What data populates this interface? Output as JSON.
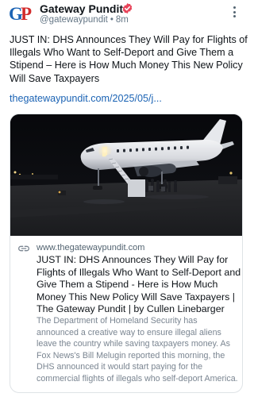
{
  "author": {
    "name": "Gateway Pundit",
    "handle": "@gatewaypundit",
    "separator": "•",
    "time": "8m",
    "avatar_letters": "GP",
    "verified": true
  },
  "post": {
    "text": "JUST IN: DHS Announces They Will Pay for Flights of Illegals Who Want to Self-Deport and Give Them a Stipend – Here is How Much Money This New Policy Will Save Taxpayers",
    "link": "thegatewaypundit.com/2025/05/j..."
  },
  "card": {
    "domain": "www.thegatewaypundit.com",
    "title": "JUST IN: DHS Announces They Will Pay for Flights of Illegals Who Want to Self-Deport and Give Them a Stipend - Here is How Much Money This New Policy Will Save Taxpayers | The Gateway Pundit | by Cullen Linebarger",
    "description": "The Department of Homeland Security has announced a creative way to ensure illegal aliens leave the country while saving taxpayers money. As Fox News's Bill Melugin reported this morning, the DHS announced it would start paying for the commercial flights of illegals who self-deport America.",
    "image": "airplane at night with boarding stairs"
  },
  "icons": {
    "more": "more-vertical-icon",
    "verified": "verified-badge-icon",
    "link": "link-icon"
  },
  "colors": {
    "accent": "#1b63b4",
    "verified_badge": "#e8445a",
    "muted_text": "#657786",
    "avatar_red": "#d22b2b"
  }
}
